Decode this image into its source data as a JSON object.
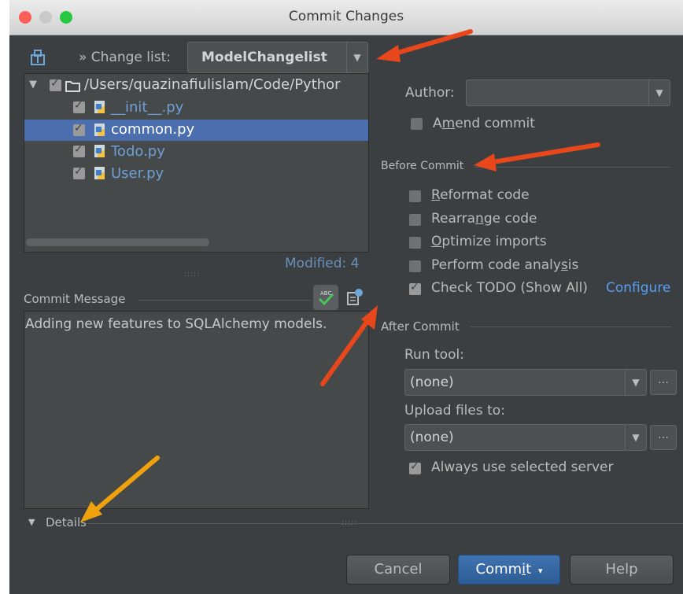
{
  "window": {
    "title": "Commit Changes"
  },
  "changelist": {
    "label": "» Change list:",
    "value": "ModelChangelist"
  },
  "tree": {
    "root": "/Users/quazinafiulislam/Code/Pythor",
    "files": [
      "__init__.py",
      "common.py",
      "Todo.py",
      "User.py"
    ],
    "selected": "common.py"
  },
  "status": {
    "modified": "Modified: 4"
  },
  "commit_message": {
    "label": "Commit Message",
    "text": "Adding new features to SQLAlchemy models."
  },
  "details_label": "Details",
  "author": {
    "label": "Author:",
    "value": ""
  },
  "amend": {
    "pre": "A",
    "mn": "m",
    "post": "end commit"
  },
  "before_commit": {
    "title": "Before Commit",
    "reformat": {
      "mn": "R",
      "rest": "eformat code"
    },
    "rearrange": {
      "pre": "Rearra",
      "mn": "n",
      "post": "ge code"
    },
    "optimize": {
      "mn": "O",
      "rest": "ptimize imports"
    },
    "analysis": {
      "pre": "Perform code analy",
      "mn": "s",
      "post": "is"
    },
    "todo": {
      "text": "Check TODO (Show All)",
      "link": "Configure"
    }
  },
  "after_commit": {
    "title": "After Commit",
    "run_tool_label": "Run tool:",
    "run_tool_value": "(none)",
    "upload_label": "Upload files to:",
    "upload_value": "(none)",
    "always_use": "Always use selected server",
    "more": "…"
  },
  "buttons": {
    "cancel": "Cancel",
    "commit": "Commit",
    "commit_pre": "Comm",
    "commit_mn": "i",
    "commit_post": "t",
    "help": "Help"
  },
  "colors": {
    "selection": "#4b6eaf",
    "link": "#589df6",
    "arrow_red": "#e8461b",
    "arrow_orange": "#f0a20c"
  }
}
